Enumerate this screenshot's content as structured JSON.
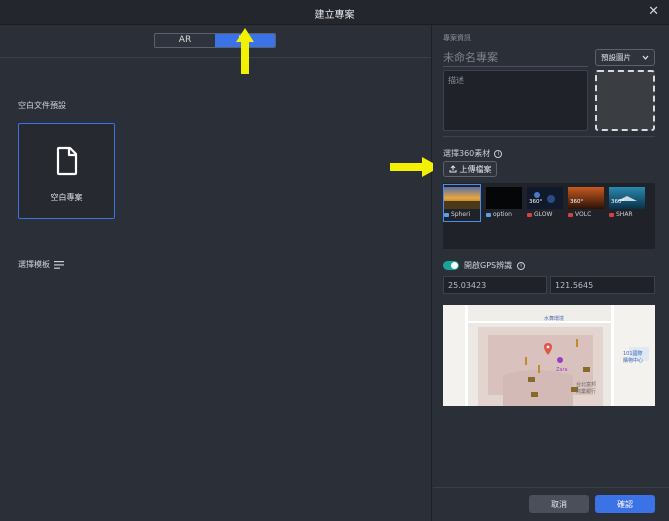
{
  "window": {
    "title": "建立專案",
    "close_symbol": "✕"
  },
  "mode_tabs": [
    {
      "label": "AR",
      "active": false
    },
    {
      "label": "VR",
      "active": true
    }
  ],
  "colors": {
    "accent": "#3b72e6",
    "toggle_on": "#1aa39a",
    "annotation_arrow": "#f2f200"
  },
  "blank_section": {
    "heading": "空白文件預設",
    "card_label": "空白專案"
  },
  "template_section": {
    "heading": "選擇模板"
  },
  "project_info": {
    "heading": "專案資訊",
    "name_placeholder": "未命名專案",
    "preset_image_label": "預設圖片",
    "description_placeholder": "描述"
  },
  "assets": {
    "heading": "選擇360素材",
    "upload_label": "上傳檔案",
    "thumbnails": [
      {
        "label": "Spheri",
        "badge": "",
        "icon": "sphere-icon",
        "selected": true
      },
      {
        "label": "option",
        "badge": "",
        "icon": "sphere-icon",
        "selected": false
      },
      {
        "label": "GLOW",
        "badge": "360°",
        "icon": "video-icon",
        "selected": false
      },
      {
        "label": "VOLC",
        "badge": "360°",
        "icon": "video-icon",
        "selected": false
      },
      {
        "label": "SHAR",
        "badge": "360°",
        "icon": "video-icon",
        "selected": false
      }
    ]
  },
  "gps": {
    "label": "開啟GPS辨識",
    "enabled": true,
    "latitude": "25.03423",
    "longitude": "121.5645"
  },
  "map": {
    "labels": [
      "水舞環境",
      "Zara",
      "台北富邦",
      "商業銀行",
      "101國際",
      "購物中心"
    ]
  },
  "footer": {
    "cancel_label": "取消",
    "confirm_label": "確認"
  }
}
